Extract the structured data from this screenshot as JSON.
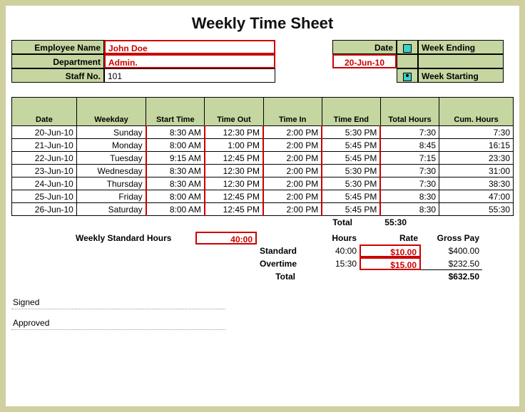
{
  "title": "Weekly Time Sheet",
  "header": {
    "emp_lbl": "Employee Name",
    "emp_val": "John Doe",
    "dept_lbl": "Department",
    "dept_val": "Admin.",
    "staff_lbl": "Staff No.",
    "staff_val": "101",
    "date_lbl": "Date",
    "date_val": "20-Jun-10",
    "wk_end": "Week Ending",
    "wk_start": "Week Starting"
  },
  "cols": {
    "date": "Date",
    "weekday": "Weekday",
    "start": "Start Time",
    "out": "Time Out",
    "in": "Time In",
    "end": "Time End",
    "total": "Total Hours",
    "cum": "Cum. Hours"
  },
  "rows": [
    {
      "date": "20-Jun-10",
      "wd": "Sunday",
      "st": "8:30 AM",
      "out": "12:30 PM",
      "in": "2:00 PM",
      "end": "5:30 PM",
      "tot": "7:30",
      "cum": "7:30"
    },
    {
      "date": "21-Jun-10",
      "wd": "Monday",
      "st": "8:00 AM",
      "out": "1:00 PM",
      "in": "2:00 PM",
      "end": "5:45 PM",
      "tot": "8:45",
      "cum": "16:15"
    },
    {
      "date": "22-Jun-10",
      "wd": "Tuesday",
      "st": "9:15 AM",
      "out": "12:45 PM",
      "in": "2:00 PM",
      "end": "5:45 PM",
      "tot": "7:15",
      "cum": "23:30"
    },
    {
      "date": "23-Jun-10",
      "wd": "Wednesday",
      "st": "8:30 AM",
      "out": "12:30 PM",
      "in": "2:00 PM",
      "end": "5:30 PM",
      "tot": "7:30",
      "cum": "31:00"
    },
    {
      "date": "24-Jun-10",
      "wd": "Thursday",
      "st": "8:30 AM",
      "out": "12:30 PM",
      "in": "2:00 PM",
      "end": "5:30 PM",
      "tot": "7:30",
      "cum": "38:30"
    },
    {
      "date": "25-Jun-10",
      "wd": "Friday",
      "st": "8:00 AM",
      "out": "12:45 PM",
      "in": "2:00 PM",
      "end": "5:45 PM",
      "tot": "8:30",
      "cum": "47:00"
    },
    {
      "date": "26-Jun-10",
      "wd": "Saturday",
      "st": "8:00 AM",
      "out": "12:45 PM",
      "in": "2:00 PM",
      "end": "5:45 PM",
      "tot": "8:30",
      "cum": "55:30"
    }
  ],
  "total_lbl": "Total",
  "total_val": "55:30",
  "std_lbl": "Weekly Standard Hours",
  "std_val": "40:00",
  "pay": {
    "hours_lbl": "Hours",
    "rate_lbl": "Rate",
    "gross_lbl": "Gross Pay",
    "std_lbl": "Standard",
    "std_hrs": "40:00",
    "std_rate": "$10.00",
    "std_pay": "$400.00",
    "ot_lbl": "Overtime",
    "ot_hrs": "15:30",
    "ot_rate": "$15.00",
    "ot_pay": "$232.50",
    "tot_lbl": "Total",
    "tot_pay": "$632.50"
  },
  "signed": "Signed",
  "approved": "Approved"
}
